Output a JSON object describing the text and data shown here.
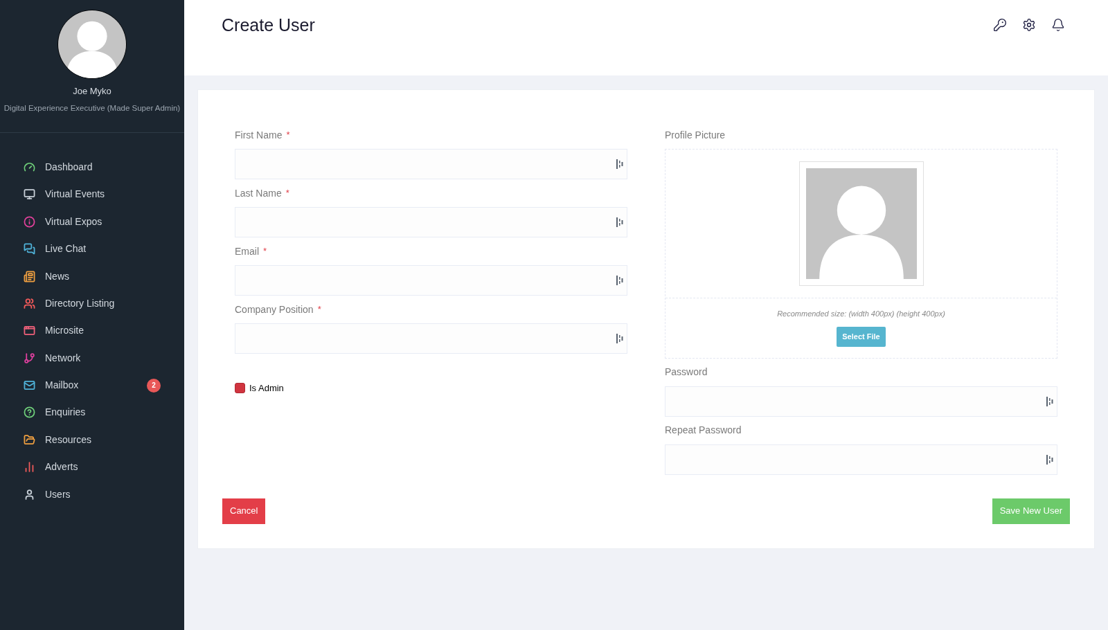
{
  "profile": {
    "name": "Joe Myko",
    "role": "Digital Experience Executive (Made Super Admin)"
  },
  "sidebar": {
    "items": [
      {
        "label": "Dashboard",
        "color": "#6fcf7a"
      },
      {
        "label": "Virtual Events",
        "color": "#c9d1d9"
      },
      {
        "label": "Virtual Expos",
        "color": "#e0409a"
      },
      {
        "label": "Live Chat",
        "color": "#4fb3d9"
      },
      {
        "label": "News",
        "color": "#f0a040"
      },
      {
        "label": "Directory Listing",
        "color": "#f05a5a"
      },
      {
        "label": "Microsite",
        "color": "#f0607a"
      },
      {
        "label": "Network",
        "color": "#e040a0"
      },
      {
        "label": "Mailbox",
        "color": "#4fb3d9",
        "badge": "2"
      },
      {
        "label": "Enquiries",
        "color": "#6fcf7a"
      },
      {
        "label": "Resources",
        "color": "#f0a040"
      },
      {
        "label": "Adverts",
        "color": "#f05a5a"
      },
      {
        "label": "Users",
        "color": "#c9d1d9"
      }
    ]
  },
  "header": {
    "title": "Create User"
  },
  "form": {
    "left_fields": [
      {
        "label": "First Name",
        "required_mark": "*"
      },
      {
        "label": "Last Name",
        "required_mark": "*"
      },
      {
        "label": "Email",
        "required_mark": "*"
      },
      {
        "label": "Company Position",
        "required_mark": "*"
      }
    ],
    "is_admin": {
      "label": "Is Admin",
      "checked": true
    },
    "profile_picture": {
      "label": "Profile Picture",
      "hint": "Recommended size: (width 400px) (height 400px)",
      "button": "Select File"
    },
    "right_fields": [
      {
        "label": "Password"
      },
      {
        "label": "Repeat Password"
      }
    ],
    "cancel": "Cancel",
    "save": "Save New User"
  }
}
